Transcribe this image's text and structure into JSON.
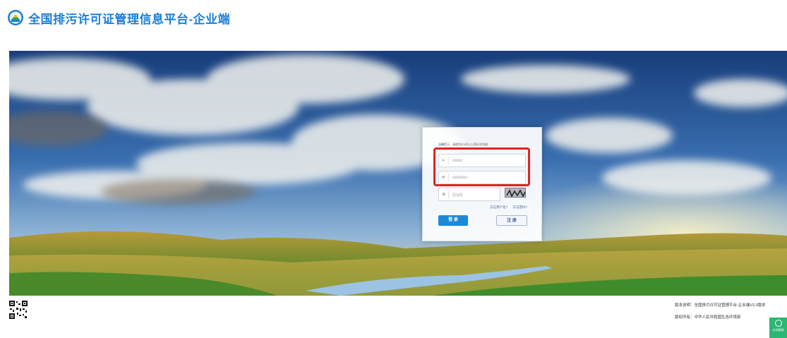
{
  "header": {
    "title": "全国排污许可证管理信息平台-企业端",
    "logo_icon": "emblem-icon"
  },
  "login": {
    "tip": "温馨提示：请使用IE9及以上版本浏览器",
    "username_value": "••••••••",
    "password_value": "••••••••••••",
    "captcha_placeholder": "验证码",
    "forgot_username": "忘记用户名?",
    "forgot_password": "忘记密码?",
    "login_label": "登 录",
    "register_label": "注 册"
  },
  "footer": {
    "version": "版本说明：全国排污许可证管理平台-企业端V2.0版本",
    "copyright": "版权所有：中华人民共和国生态环境部"
  },
  "help": {
    "label": "在线客服"
  },
  "colors": {
    "accent": "#1c7fd6",
    "highlight": "#e02323",
    "help": "#2bb673"
  }
}
